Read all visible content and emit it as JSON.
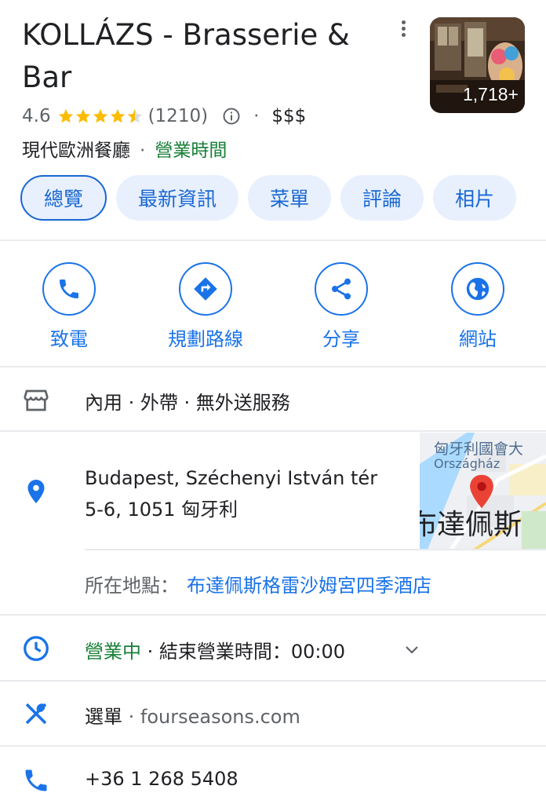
{
  "place": {
    "name": "KOLLÁZS - Brasserie & Bar",
    "rating": "4.6",
    "review_count": "(1210)",
    "price": "$$$",
    "category": "現代歐洲餐廳",
    "hours_link": "營業時間",
    "photo_count": "1,718+"
  },
  "tabs": [
    "總覽",
    "最新資訊",
    "菜單",
    "評論",
    "相片"
  ],
  "actions": [
    {
      "label": "致電",
      "icon": "phone-icon"
    },
    {
      "label": "規劃路線",
      "icon": "directions-icon"
    },
    {
      "label": "分享",
      "icon": "share-icon"
    },
    {
      "label": "網站",
      "icon": "globe-icon"
    }
  ],
  "service_options": "內用 · 外帶 · 無外送服務",
  "address": {
    "line1": "Budapest, Széchenyi István tér",
    "line2": "5-6, 1051 匈牙利"
  },
  "map": {
    "label_cn": "匈牙利國會大",
    "label_hu": "Országház",
    "city": "布達佩斯"
  },
  "located_in": {
    "label": "所在地點：",
    "value": "布達佩斯格雷沙姆宮四季酒店"
  },
  "hours": {
    "status": "營業中",
    "sep": " · ",
    "closing": "結束營業時間：00:00"
  },
  "menu": {
    "label": "選單",
    "sep": " · ",
    "site": "fourseasons.com"
  },
  "phone": "+36 1 268 5408",
  "colors": {
    "accent": "#1a73e8",
    "open": "#188038",
    "star": "#fbbc04"
  }
}
